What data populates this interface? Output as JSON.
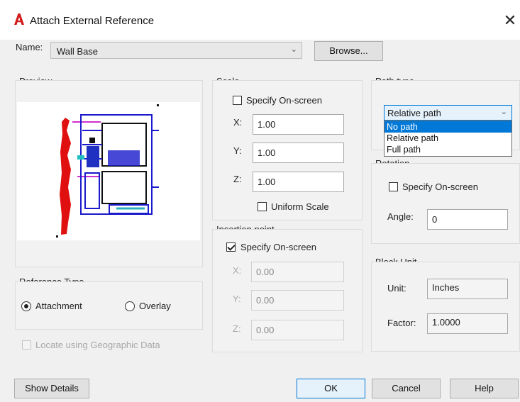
{
  "title": "Attach External Reference",
  "close_glyph": "✕",
  "name_label": "Name:",
  "name_value": "Wall Base",
  "browse_label": "Browse...",
  "preview_title": "Preview",
  "scale": {
    "title": "Scale",
    "specify_label": "Specify On-screen",
    "specify_checked": false,
    "x_label": "X:",
    "x_value": "1.00",
    "y_label": "Y:",
    "y_value": "1.00",
    "z_label": "Z:",
    "z_value": "1.00",
    "uniform_label": "Uniform Scale",
    "uniform_checked": false
  },
  "insertion": {
    "title": "Insertion point",
    "specify_label": "Specify On-screen",
    "specify_checked": true,
    "x_label": "X:",
    "x_value": "0.00",
    "y_label": "Y:",
    "y_value": "0.00",
    "z_label": "Z:",
    "z_value": "0.00"
  },
  "path_type": {
    "title": "Path type",
    "selected": "Relative path",
    "options": [
      "No path",
      "Relative path",
      "Full path"
    ],
    "highlighted": "No path"
  },
  "rotation": {
    "title": "Rotation",
    "specify_label": "Specify On-screen",
    "specify_checked": false,
    "angle_label": "Angle:",
    "angle_value": "0"
  },
  "block_unit": {
    "title": "Block Unit",
    "unit_label": "Unit:",
    "unit_value": "Inches",
    "factor_label": "Factor:",
    "factor_value": "1.0000"
  },
  "reference_type": {
    "title": "Reference Type",
    "attachment_label": "Attachment",
    "overlay_label": "Overlay",
    "selected": "Attachment"
  },
  "locate_geo_label": "Locate using Geographic Data",
  "buttons": {
    "show_details": "Show Details",
    "ok": "OK",
    "cancel": "Cancel",
    "help": "Help"
  },
  "colors": {
    "accent": "#0078d7",
    "logo_red": "#d11a1a",
    "drawing_blue": "#1a1acc",
    "drawing_red": "#e01010"
  }
}
